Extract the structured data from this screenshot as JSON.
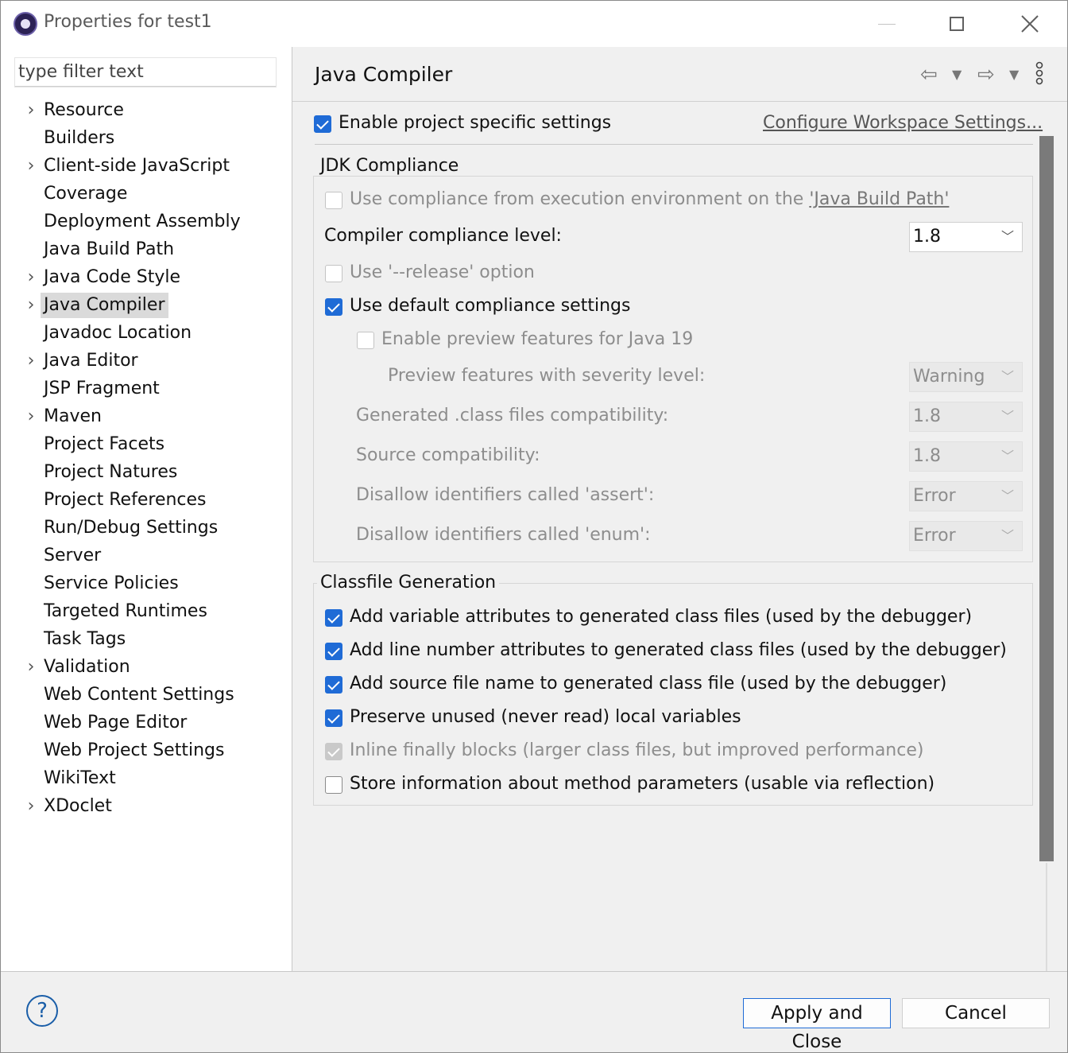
{
  "window": {
    "title": "Properties for test1"
  },
  "filter": {
    "placeholder": "type filter text"
  },
  "tree": {
    "items": [
      {
        "label": "Resource",
        "expandable": true
      },
      {
        "label": "Builders",
        "expandable": false
      },
      {
        "label": "Client-side JavaScript",
        "expandable": true
      },
      {
        "label": "Coverage",
        "expandable": false
      },
      {
        "label": "Deployment Assembly",
        "expandable": false
      },
      {
        "label": "Java Build Path",
        "expandable": false
      },
      {
        "label": "Java Code Style",
        "expandable": true
      },
      {
        "label": "Java Compiler",
        "expandable": true,
        "selected": true
      },
      {
        "label": "Javadoc Location",
        "expandable": false
      },
      {
        "label": "Java Editor",
        "expandable": true
      },
      {
        "label": "JSP Fragment",
        "expandable": false
      },
      {
        "label": "Maven",
        "expandable": true
      },
      {
        "label": "Project Facets",
        "expandable": false
      },
      {
        "label": "Project Natures",
        "expandable": false
      },
      {
        "label": "Project References",
        "expandable": false
      },
      {
        "label": "Run/Debug Settings",
        "expandable": false
      },
      {
        "label": "Server",
        "expandable": false
      },
      {
        "label": "Service Policies",
        "expandable": false
      },
      {
        "label": "Targeted Runtimes",
        "expandable": false
      },
      {
        "label": "Task Tags",
        "expandable": false
      },
      {
        "label": "Validation",
        "expandable": true
      },
      {
        "label": "Web Content Settings",
        "expandable": false
      },
      {
        "label": "Web Page Editor",
        "expandable": false
      },
      {
        "label": "Web Project Settings",
        "expandable": false
      },
      {
        "label": "WikiText",
        "expandable": false
      },
      {
        "label": "XDoclet",
        "expandable": true
      }
    ]
  },
  "page": {
    "title": "Java Compiler",
    "enable_project_specific": {
      "label": "Enable project specific settings",
      "checked": true
    },
    "configure_link": "Configure Workspace Settings...",
    "jdk": {
      "title": "JDK Compliance",
      "use_compliance_prefix": "Use compliance from execution environment on the ",
      "use_compliance_link": "'Java Build Path'",
      "use_compliance_checked": false,
      "compliance_level_label": "Compiler compliance level:",
      "compliance_level_value": "1.8",
      "release_option": {
        "label": "Use '--release' option",
        "checked": false
      },
      "default_compliance": {
        "label": "Use default compliance settings",
        "checked": true
      },
      "preview_features": {
        "label": "Enable preview features for Java 19",
        "checked": false
      },
      "preview_severity_label": "Preview features with severity level:",
      "preview_severity_value": "Warning",
      "generated_class_label": "Generated .class files compatibility:",
      "generated_class_value": "1.8",
      "source_compat_label": "Source compatibility:",
      "source_compat_value": "1.8",
      "assert_label": "Disallow identifiers called 'assert':",
      "assert_value": "Error",
      "enum_label": "Disallow identifiers called 'enum':",
      "enum_value": "Error"
    },
    "classfile": {
      "title": "Classfile Generation",
      "options": [
        {
          "label": "Add variable attributes to generated class files (used by the debugger)",
          "checked": true,
          "enabled": true
        },
        {
          "label": "Add line number attributes to generated class files (used by the debugger)",
          "checked": true,
          "enabled": true
        },
        {
          "label": "Add source file name to generated class file (used by the debugger)",
          "checked": true,
          "enabled": true
        },
        {
          "label": "Preserve unused (never read) local variables",
          "checked": true,
          "enabled": true
        },
        {
          "label": "Inline finally blocks (larger class files, but improved performance)",
          "checked": true,
          "enabled": false
        },
        {
          "label": "Store information about method parameters (usable via reflection)",
          "checked": false,
          "enabled": true
        }
      ]
    }
  },
  "buttons": {
    "help": "?",
    "apply_close": "Apply and Close",
    "cancel": "Cancel"
  },
  "colors": {
    "accent": "#1f6bd6",
    "selection": "#dadada"
  }
}
